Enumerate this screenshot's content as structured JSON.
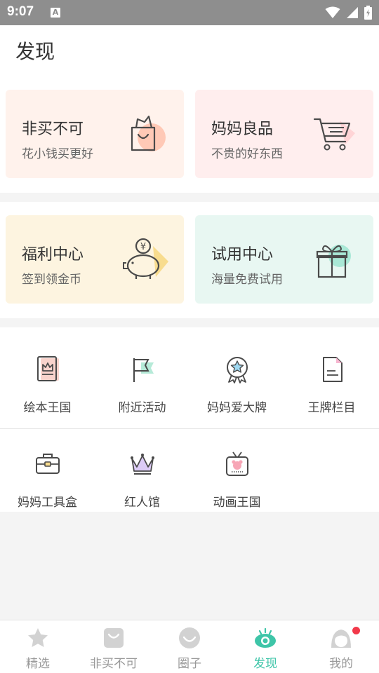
{
  "status_bar": {
    "time": "9:07",
    "notif_icon": "A"
  },
  "header": {
    "title": "发现"
  },
  "cards": [
    {
      "title": "非买不可",
      "subtitle": "花小钱买更好",
      "icon": "shopping-bag-icon",
      "bg": "#fff2ec",
      "accent": "#ffc9b6"
    },
    {
      "title": "妈妈良品",
      "subtitle": "不贵的好东西",
      "icon": "shopping-cart-icon",
      "bg": "#ffeeee",
      "accent": "#ffd4d6"
    },
    {
      "title": "福利中心",
      "subtitle": "签到领金币",
      "icon": "piggy-bank-icon",
      "bg": "#fdf4e0",
      "accent": "#f8dc8e"
    },
    {
      "title": "试用中心",
      "subtitle": "海量免费试用",
      "icon": "gift-box-icon",
      "bg": "#e8f7f2",
      "accent": "#a9e8d6"
    }
  ],
  "grid": [
    {
      "label": "绘本王国",
      "icon": "picture-book-icon"
    },
    {
      "label": "附近活动",
      "icon": "flag-icon"
    },
    {
      "label": "妈妈爱大牌",
      "icon": "medal-icon"
    },
    {
      "label": "王牌栏目",
      "icon": "document-icon"
    },
    {
      "label": "妈妈工具盒",
      "icon": "toolbox-icon"
    },
    {
      "label": "红人馆",
      "icon": "crown-icon"
    },
    {
      "label": "动画王国",
      "icon": "tv-icon"
    }
  ],
  "tabs": [
    {
      "label": "精选",
      "icon": "star-icon",
      "active": false
    },
    {
      "label": "非买不可",
      "icon": "bag-icon",
      "active": false
    },
    {
      "label": "圈子",
      "icon": "smile-icon",
      "active": false
    },
    {
      "label": "发现",
      "icon": "eye-icon",
      "active": true
    },
    {
      "label": "我的",
      "icon": "profile-icon",
      "active": false,
      "badge": true
    }
  ],
  "colors": {
    "accent_active": "#3ec5a8",
    "tab_inactive": "#999999",
    "badge": "#f2394a"
  }
}
